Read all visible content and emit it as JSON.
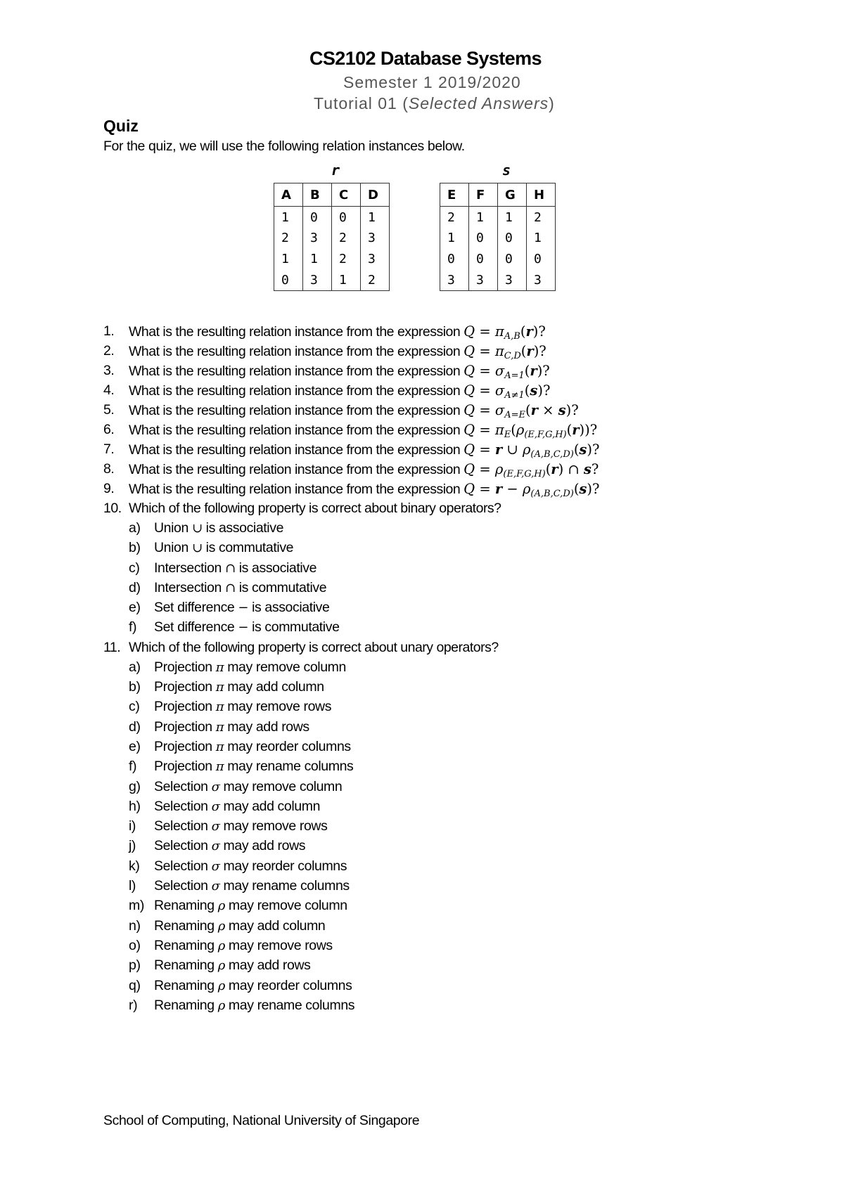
{
  "header": {
    "title": "CS2102 Database Systems",
    "semester": "Semester 1 2019/2020",
    "tutorial_prefix": "Tutorial 01 (",
    "tutorial_italic": "Selected Answers",
    "tutorial_suffix": ")"
  },
  "section": {
    "title": "Quiz",
    "intro": "For the quiz, we will use the following relation instances below."
  },
  "relations": {
    "r": {
      "name": "r",
      "columns": [
        "A",
        "B",
        "C",
        "D"
      ],
      "rows": [
        [
          "1",
          "0",
          "0",
          "1"
        ],
        [
          "2",
          "3",
          "2",
          "3"
        ],
        [
          "1",
          "1",
          "2",
          "3"
        ],
        [
          "0",
          "3",
          "1",
          "2"
        ]
      ]
    },
    "s": {
      "name": "s",
      "columns": [
        "E",
        "F",
        "G",
        "H"
      ],
      "rows": [
        [
          "2",
          "1",
          "1",
          "2"
        ],
        [
          "1",
          "0",
          "0",
          "1"
        ],
        [
          "0",
          "0",
          "0",
          "0"
        ],
        [
          "3",
          "3",
          "3",
          "3"
        ]
      ]
    }
  },
  "questions": [
    {
      "num": "1.",
      "text": "What is the resulting relation instance from the expression ",
      "expr": "Q = π_{A,B}(r)?"
    },
    {
      "num": "2.",
      "text": "What is the resulting relation instance from the expression ",
      "expr": "Q = π_{C,D}(r)?"
    },
    {
      "num": "3.",
      "text": "What is the resulting relation instance from the expression ",
      "expr": "Q = σ_{A=1}(r)?"
    },
    {
      "num": "4.",
      "text": "What is the resulting relation instance from the expression ",
      "expr": "Q = σ_{A≠1}(s)?"
    },
    {
      "num": "5.",
      "text": "What is the resulting relation instance from the expression ",
      "expr": "Q = σ_{A=E}(r × s)?"
    },
    {
      "num": "6.",
      "text": "What is the resulting relation instance from the expression ",
      "expr": "Q = π_E(ρ_{(E,F,G,H)}(r))?"
    },
    {
      "num": "7.",
      "text": "What is the resulting relation instance from the expression ",
      "expr": "Q = r ∪ ρ_{(A,B,C,D)}(s)?"
    },
    {
      "num": "8.",
      "text": "What is the resulting relation instance from the expression ",
      "expr": "Q = ρ_{(E,F,G,H)}(r) ∩ s?"
    },
    {
      "num": "9.",
      "text": "What is the resulting relation instance from the expression ",
      "expr": "Q = r − ρ_{(A,B,C,D)}(s)?"
    },
    {
      "num": "10.",
      "text": "Which of the following property is correct about binary operators?",
      "options": [
        {
          "letter": "a)",
          "pre": "Union ",
          "sym": "∪",
          "post": " is associative"
        },
        {
          "letter": "b)",
          "pre": "Union ",
          "sym": "∪",
          "post": " is commutative"
        },
        {
          "letter": "c)",
          "pre": "Intersection ",
          "sym": "∩",
          "post": " is associative"
        },
        {
          "letter": "d)",
          "pre": "Intersection ",
          "sym": "∩",
          "post": " is commutative"
        },
        {
          "letter": "e)",
          "pre": "Set difference ",
          "sym": "−",
          "post": " is associative"
        },
        {
          "letter": "f)",
          "pre": "Set difference ",
          "sym": "−",
          "post": " is commutative"
        }
      ]
    },
    {
      "num": "11.",
      "text": "Which of the following property is correct about unary operators?",
      "options": [
        {
          "letter": "a)",
          "pre": "Projection ",
          "sym": "π",
          "post": " may remove column"
        },
        {
          "letter": "b)",
          "pre": "Projection ",
          "sym": "π",
          "post": " may add column"
        },
        {
          "letter": "c)",
          "pre": "Projection ",
          "sym": "π",
          "post": " may remove rows"
        },
        {
          "letter": "d)",
          "pre": "Projection ",
          "sym": "π",
          "post": " may add rows"
        },
        {
          "letter": "e)",
          "pre": "Projection ",
          "sym": "π",
          "post": " may reorder columns"
        },
        {
          "letter": "f)",
          "pre": "Projection ",
          "sym": "π",
          "post": " may rename columns"
        },
        {
          "letter": "g)",
          "pre": "Selection ",
          "sym": "σ",
          "post": " may remove column"
        },
        {
          "letter": "h)",
          "pre": "Selection ",
          "sym": "σ",
          "post": " may add column"
        },
        {
          "letter": "i)",
          "pre": "Selection ",
          "sym": "σ",
          "post": " may remove rows"
        },
        {
          "letter": "j)",
          "pre": "Selection ",
          "sym": "σ",
          "post": " may add rows"
        },
        {
          "letter": "k)",
          "pre": "Selection ",
          "sym": "σ",
          "post": " may reorder columns"
        },
        {
          "letter": "l)",
          "pre": "Selection ",
          "sym": "σ",
          "post": " may rename columns"
        },
        {
          "letter": "m)",
          "pre": "Renaming ",
          "sym": "ρ",
          "post": " may remove column"
        },
        {
          "letter": "n)",
          "pre": "Renaming ",
          "sym": "ρ",
          "post": " may add column"
        },
        {
          "letter": "o)",
          "pre": "Renaming ",
          "sym": "ρ",
          "post": " may remove rows"
        },
        {
          "letter": "p)",
          "pre": "Renaming ",
          "sym": "ρ",
          "post": " may add rows"
        },
        {
          "letter": "q)",
          "pre": "Renaming ",
          "sym": "ρ",
          "post": " may reorder columns"
        },
        {
          "letter": "r)",
          "pre": "Renaming ",
          "sym": "ρ",
          "post": " may rename columns"
        }
      ]
    }
  ],
  "footer": {
    "text": "School of Computing, National University of Singapore"
  }
}
